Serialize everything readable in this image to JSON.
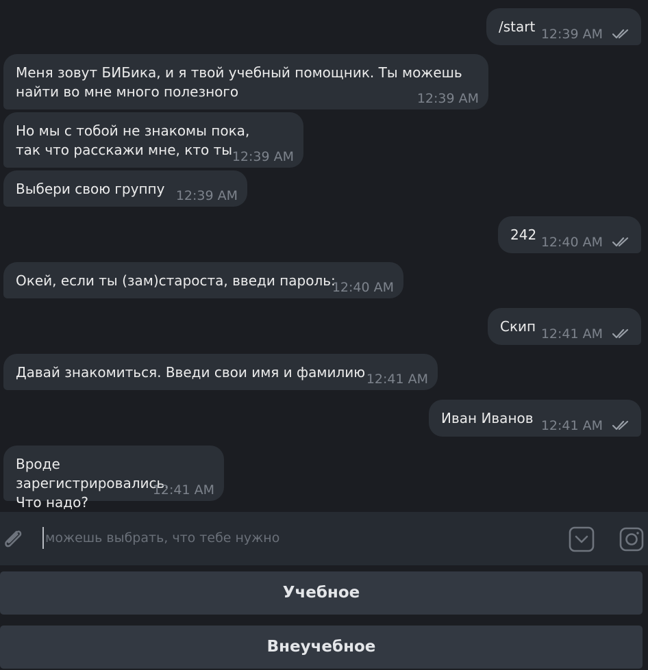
{
  "messages": [
    {
      "direction": "out",
      "text": "/start",
      "time": "12:39 AM",
      "status_icon": "double-check-icon"
    },
    {
      "direction": "in",
      "text": "Меня зовут БИБика, и я твой учебный помощник. Ты можешь\nнайти во мне много полезного",
      "time": "12:39 AM"
    },
    {
      "direction": "in",
      "text": "Но мы с тобой не знакомы пока,\nтак что расскажи мне, кто ты",
      "time": "12:39 AM"
    },
    {
      "direction": "in",
      "text": "Выбери свою группу",
      "time": "12:39 AM"
    },
    {
      "direction": "out",
      "text": "242",
      "time": "12:40 AM",
      "status_icon": "double-check-icon"
    },
    {
      "direction": "in",
      "text": "Окей, если ты (зам)староста, введи пароль:",
      "time": "12:40 AM"
    },
    {
      "direction": "out",
      "text": "Скип",
      "time": "12:41 AM",
      "status_icon": "double-check-icon"
    },
    {
      "direction": "in",
      "text": "Давай знакомиться. Введи свои имя и фамилию",
      "time": "12:41 AM"
    },
    {
      "direction": "out",
      "text": "Иван Иванов",
      "time": "12:41 AM",
      "status_icon": "double-check-icon"
    },
    {
      "direction": "in",
      "text": "Вроде зарегистрировались.\nЧто надо?",
      "time": "12:41 AM"
    }
  ],
  "composer": {
    "placeholder": "можешь выбрать, что тебе нужно",
    "value": "",
    "icons": [
      "paperclip-icon",
      "keyboard-toggle-icon",
      "camera-icon"
    ]
  },
  "keyboard": {
    "buttons": [
      "Учебное",
      "Внеучебное"
    ]
  },
  "colors": {
    "background": "#1b1d22",
    "bubble": "#2b3037",
    "composer": "#262b32",
    "keyboard_button": "#333942",
    "timestamp": "#7d838c",
    "text": "#ececec"
  }
}
